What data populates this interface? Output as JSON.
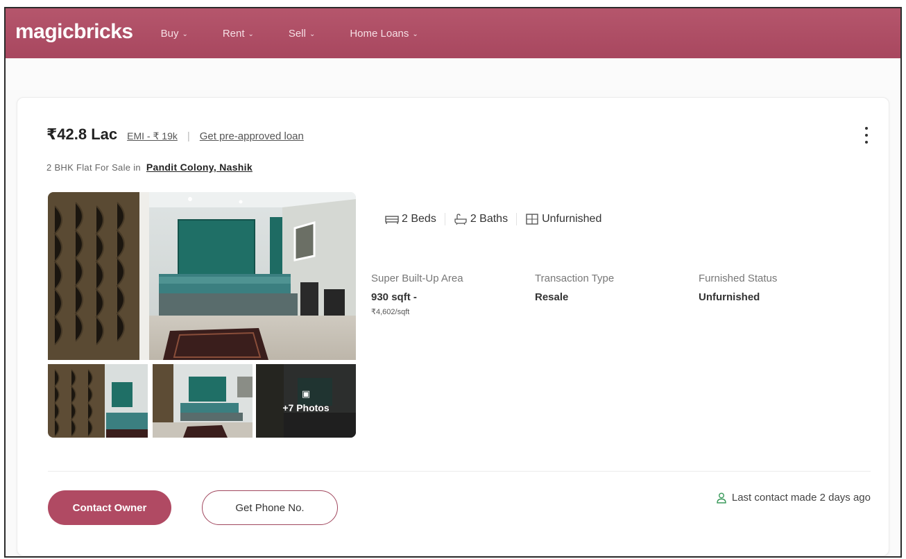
{
  "header": {
    "logo": "magicbricks",
    "nav": [
      {
        "label": "Buy"
      },
      {
        "label": "Rent"
      },
      {
        "label": "Sell"
      },
      {
        "label": "Home Loans"
      }
    ]
  },
  "listing": {
    "price": "₹42.8 Lac",
    "emi": "EMI - ₹ 19k",
    "separator": "|",
    "loan_link": "Get pre-approved loan",
    "title_prefix": "2 BHK Flat For Sale in",
    "location": "Pandit Colony, Nashik",
    "more_photos": "+7 Photos",
    "amenities": {
      "beds": "2 Beds",
      "baths": "2 Baths",
      "furnishing": "Unfurnished"
    },
    "summary": [
      {
        "label": "Super Built-Up Area",
        "value": "930 sqft -",
        "sub": "₹4,602/sqft"
      },
      {
        "label": "Transaction Type",
        "value": "Resale"
      },
      {
        "label": "Furnished Status",
        "value": "Unfurnished"
      }
    ],
    "contact_button": "Contact Owner",
    "phone_button": "Get Phone No.",
    "last_contact": "Last contact made 2 days ago"
  },
  "colors": {
    "brand": "#b04a63",
    "header": "#a8475f",
    "accent_green": "#3a9a5b"
  },
  "icons": [
    "kebab-menu-icon",
    "bed-icon",
    "bath-icon",
    "furnishing-icon",
    "gallery-icon",
    "person-icon",
    "chevron-down-icon"
  ]
}
